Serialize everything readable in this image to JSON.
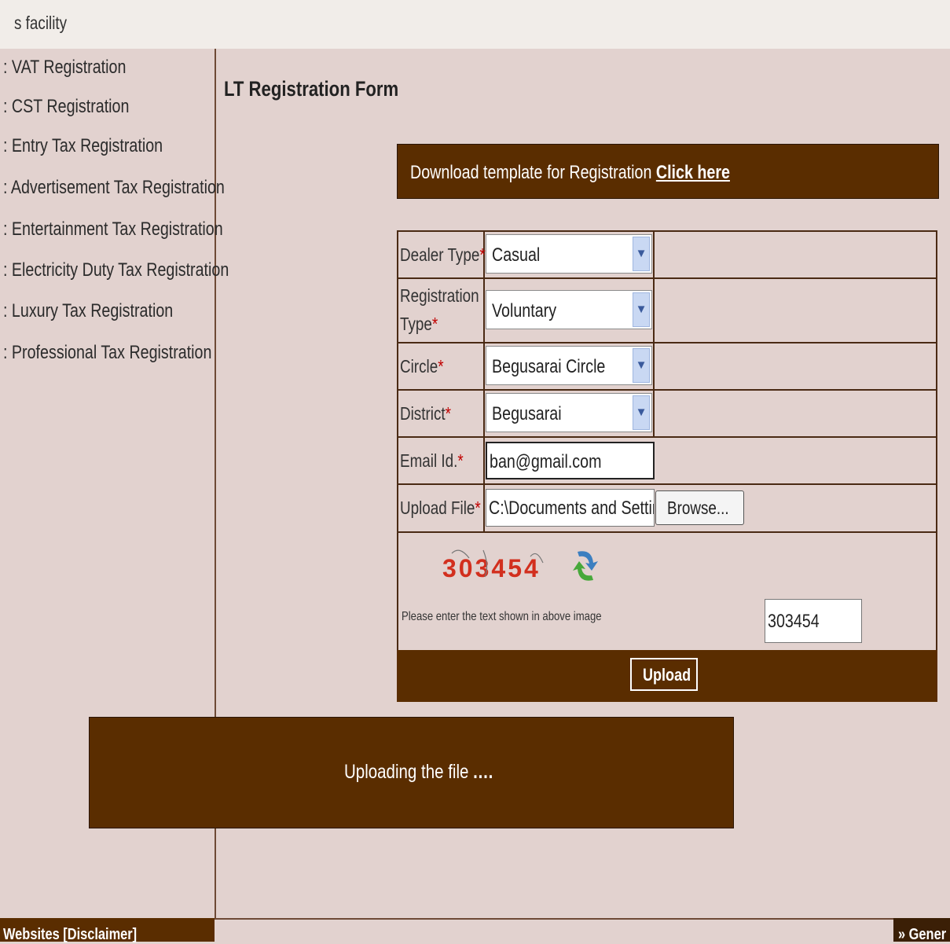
{
  "header": {
    "facility_text": "s facility"
  },
  "sidebar": {
    "items": [
      {
        "label": ": VAT Registration"
      },
      {
        "label": ": CST Registration"
      },
      {
        "label": ": Entry Tax Registration"
      },
      {
        "label": ": Advertisement Tax Registration"
      },
      {
        "label": ": Entertainment Tax Registration"
      },
      {
        "label": ": Electricity Duty Tax Registration"
      },
      {
        "label": ": Luxury Tax Registration"
      },
      {
        "label": ": Professional Tax Registration"
      }
    ]
  },
  "main": {
    "title": "LT Registration Form",
    "download": {
      "text": "Download template for Registration",
      "link": "Click here"
    },
    "form": {
      "dealer_type": {
        "label": "Dealer Type",
        "value": "Casual"
      },
      "registration_type": {
        "label_line1": "Registration",
        "label_line2": "Type",
        "value": "Voluntary"
      },
      "circle": {
        "label": "Circle",
        "value": "Begusarai Circle"
      },
      "district": {
        "label": "District",
        "value": "Begusarai"
      },
      "email": {
        "label": "Email Id.",
        "value": "ban@gmail.com"
      },
      "upload_file": {
        "label": "Upload File",
        "value": "C:\\Documents and Settin",
        "browse_label": "Browse..."
      },
      "required_mark": "*",
      "captcha": {
        "image_text": "303454",
        "prompt": "Please enter the text shown in above image",
        "value": "303454"
      }
    },
    "upload_button": "Upload",
    "status": {
      "message": "Uploading the file",
      "dots": "...."
    }
  },
  "footer": {
    "left_text": "Websites [Disclaimer]",
    "right_text": "» Gener"
  },
  "colors": {
    "brown": "#5a2d00",
    "page_bg": "#e2d2cf",
    "required": "#c00000",
    "captcha_red": "#d22f1e"
  }
}
